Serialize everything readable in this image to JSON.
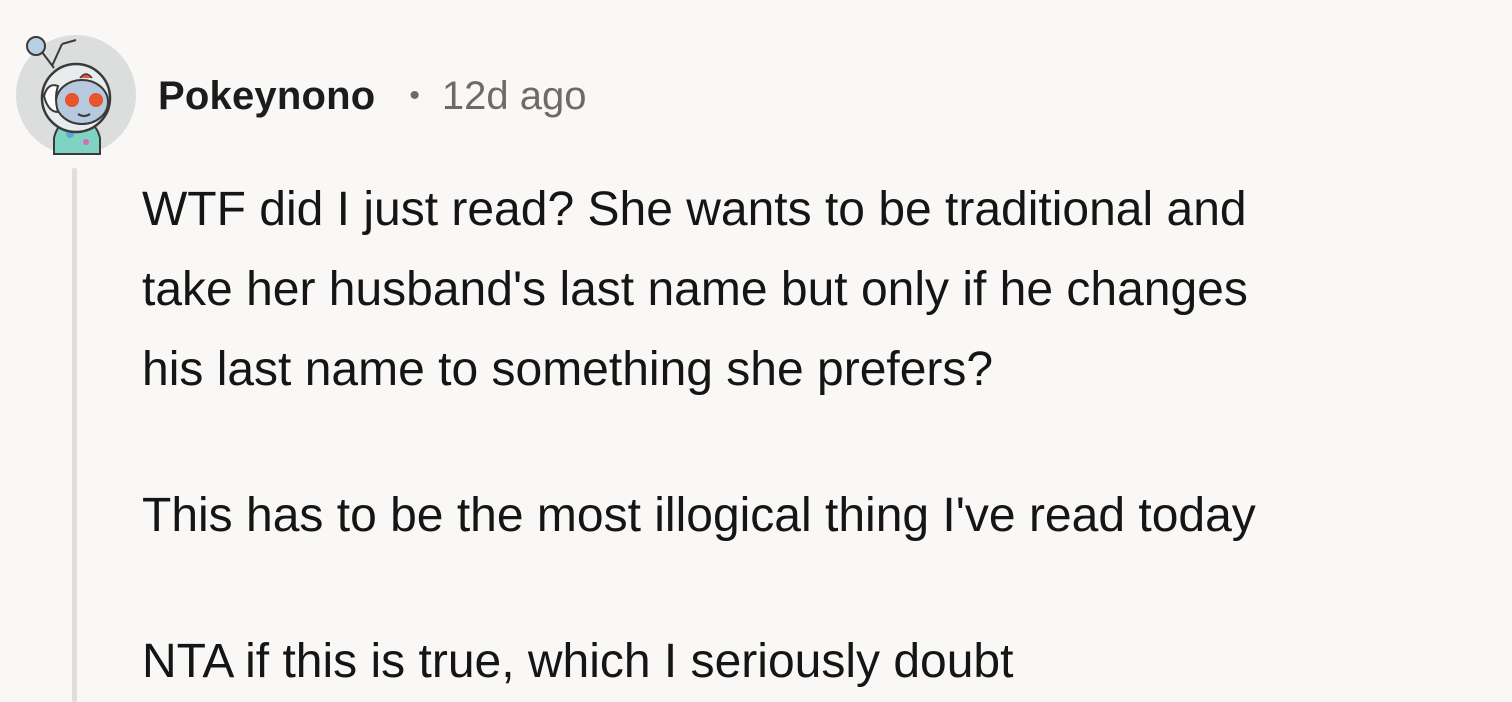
{
  "comment": {
    "username": "Pokeynono",
    "separator": "•",
    "timestamp": "12d ago",
    "avatar": "reddit-snoo-astronaut-avatar",
    "paragraphs": [
      {
        "lines": [
          "WTF did I just read? She wants to be traditional and",
          "take her husband's last name but only if he changes",
          "his last name to something she prefers?"
        ]
      },
      {
        "lines": [
          "This has to be the most illogical thing I've read today"
        ]
      },
      {
        "lines": [
          "NTA if this is true, which I seriously doubt"
        ]
      }
    ]
  },
  "colors": {
    "background": "#f9f8f6",
    "thread_line": "#e3ddd8",
    "meta_text": "#6f6a66",
    "avatar_accent": "#e8542b"
  }
}
